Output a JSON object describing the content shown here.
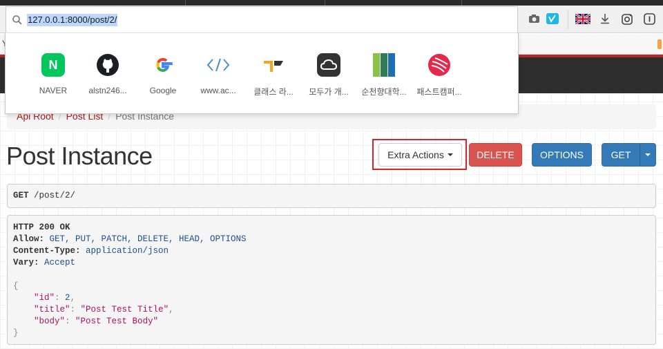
{
  "browser": {
    "url": "127.0.0.1:8000/post/2/",
    "toolbar_icons": [
      "camera-icon",
      "vimeo-icon",
      "uk-flag-icon",
      "download-icon",
      "instagram-icon",
      "info-icon"
    ],
    "bookmark_peek": "Y"
  },
  "suggestions": [
    {
      "label": "NAVER",
      "icon": "naver-icon",
      "color": "#03c75a",
      "glyph": "N"
    },
    {
      "label": "alstn246...",
      "icon": "github-icon",
      "color": "#1b1f23",
      "glyph": ""
    },
    {
      "label": "Google",
      "icon": "google-icon",
      "color": "#4285f4",
      "glyph": "G"
    },
    {
      "label": "www.ac...",
      "icon": "code-brackets-icon",
      "color": "#4a90c8",
      "glyph": "</>"
    },
    {
      "label": "클래스 라...",
      "icon": "class101-icon",
      "color": "#f5a623",
      "glyph": ""
    },
    {
      "label": "모두가 개...",
      "icon": "cloud-icon",
      "color": "#333333",
      "glyph": ""
    },
    {
      "label": "순천향대학...",
      "icon": "sch-icon",
      "color": "#2e7d57",
      "glyph": ""
    },
    {
      "label": "패스트캠퍼...",
      "icon": "fastcampus-icon",
      "color": "#e5284b",
      "glyph": ""
    }
  ],
  "breadcrumb": {
    "items": [
      "Api Root",
      "Post List",
      "Post Instance"
    ]
  },
  "page": {
    "title": "Post Instance"
  },
  "actions": {
    "extra_label": "Extra Actions",
    "delete_label": "DELETE",
    "options_label": "OPTIONS",
    "get_label": "GET"
  },
  "request": {
    "method": "GET",
    "path": " /post/2/"
  },
  "response": {
    "status": "HTTP 200 OK",
    "allow_key": "Allow:",
    "allow_val": " GET, PUT, PATCH, DELETE, HEAD, OPTIONS",
    "ctype_key": "Content-Type:",
    "ctype_val": " application/json",
    "vary_key": "Vary:",
    "vary_val": " Accept",
    "open_brace": "{",
    "id_key": "\"id\"",
    "id_val": "2",
    "title_key": "\"title\"",
    "title_val": "\"Post Test Title\"",
    "body_key": "\"body\"",
    "body_val": "\"Post Test Body\"",
    "close_brace": "}"
  },
  "colors": {
    "link": "#a32121",
    "delete": "#d9534f",
    "primary": "#337ab7",
    "highlight": "#d9232b"
  }
}
